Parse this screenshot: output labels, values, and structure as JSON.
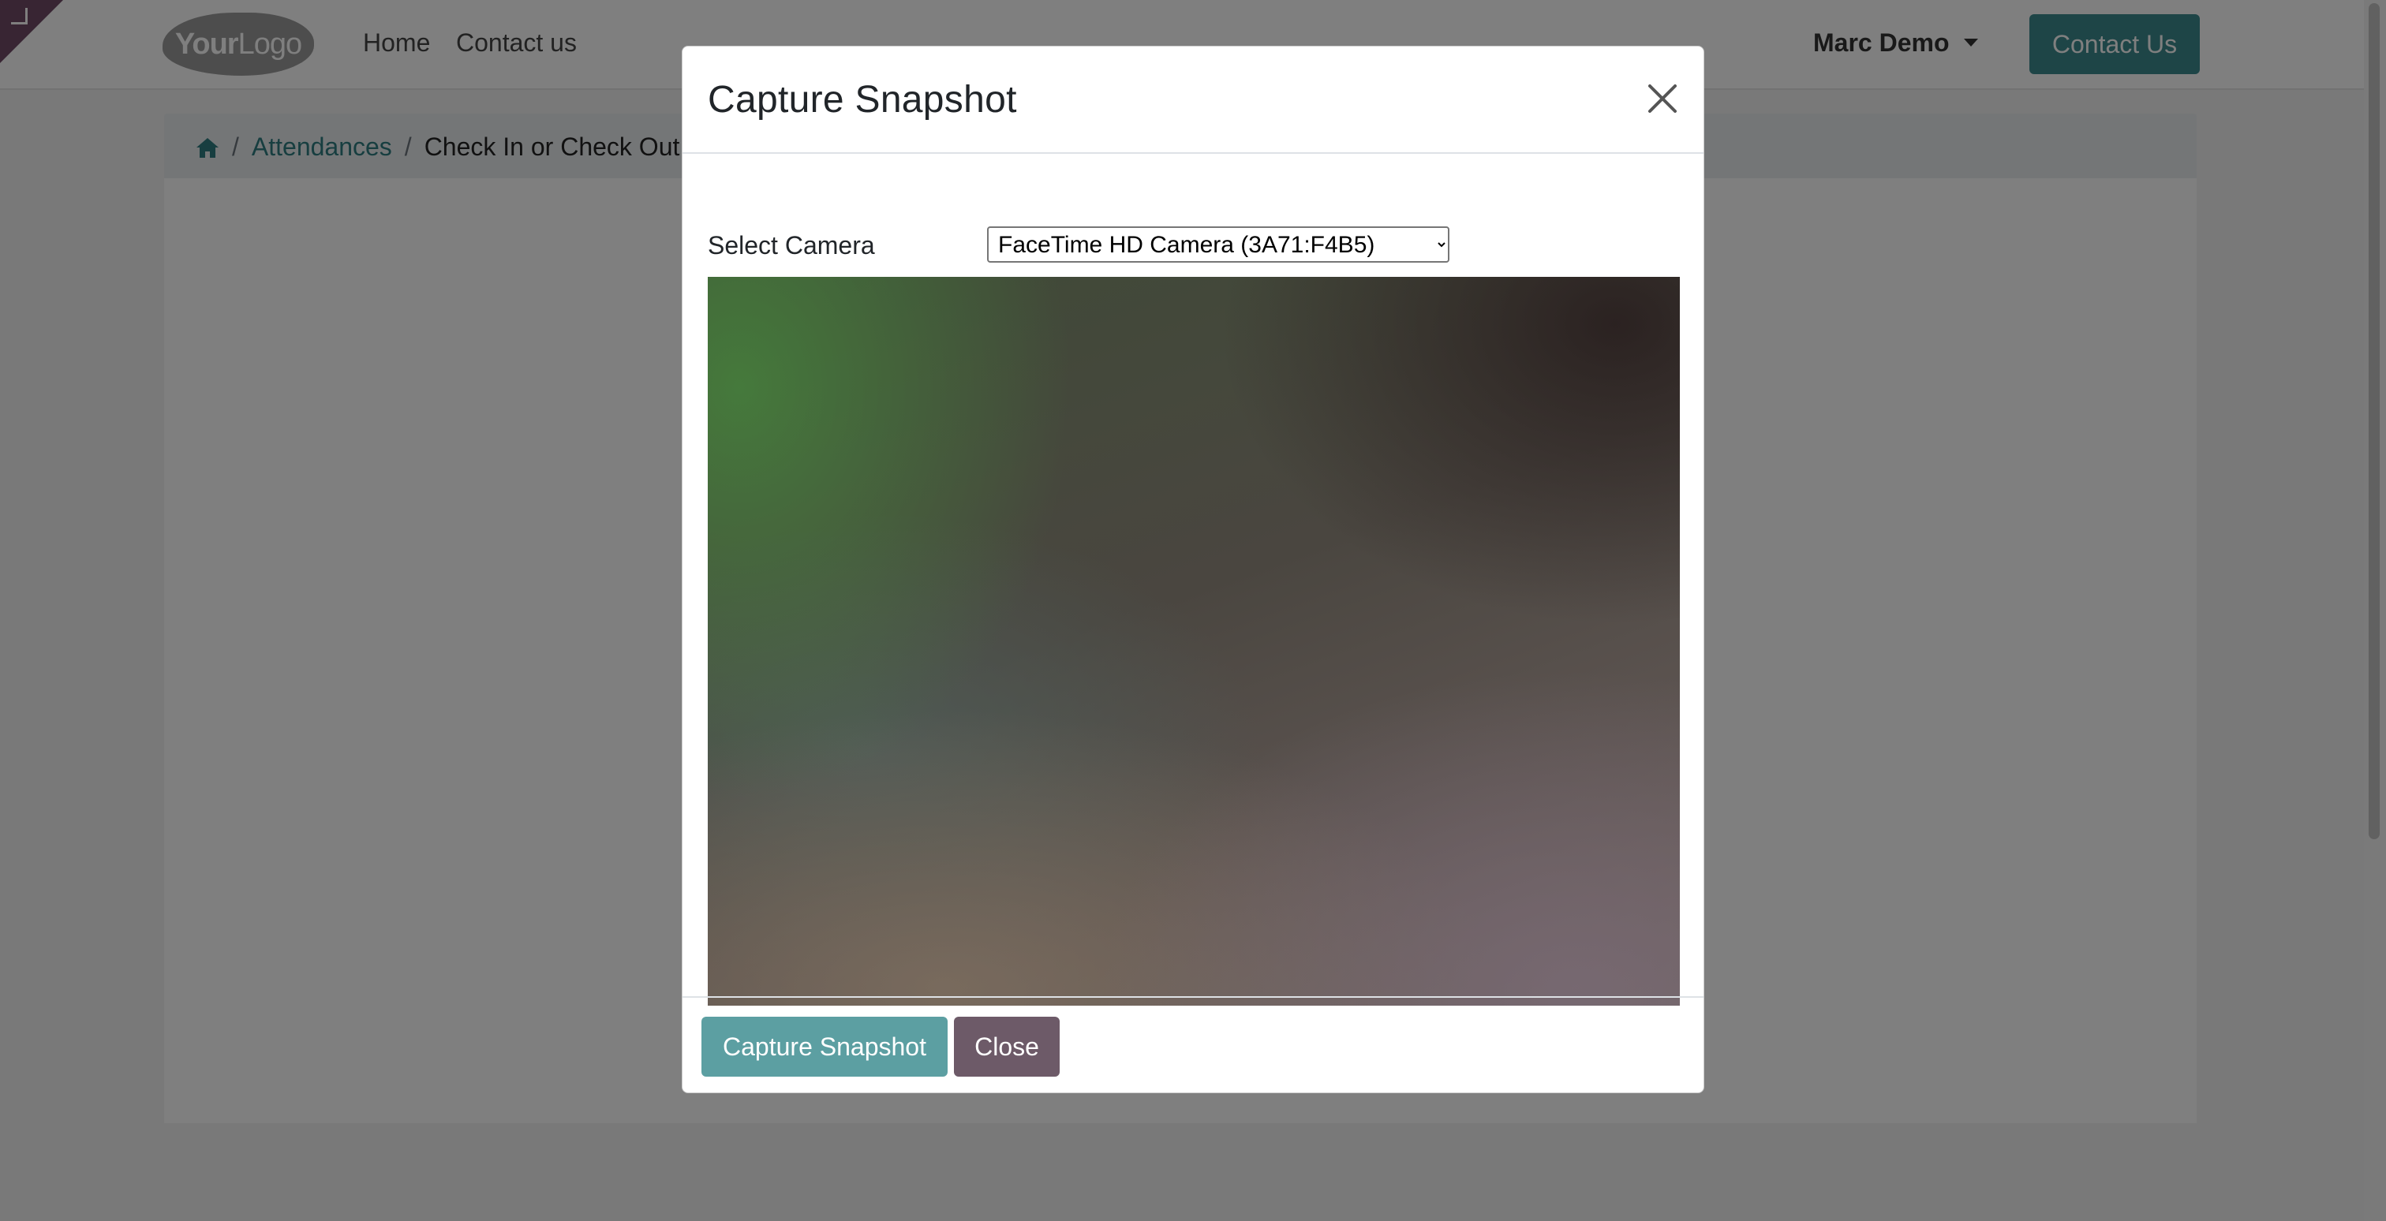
{
  "navbar": {
    "logo_text_bold": "Your",
    "logo_text_light": "Logo",
    "links": [
      "Home",
      "Contact us"
    ],
    "user_name": "Marc Demo",
    "cta_label": "Contact Us"
  },
  "breadcrumb": {
    "items": [
      "Attendances",
      "Check In or Check Out"
    ]
  },
  "modal": {
    "title": "Capture Snapshot",
    "camera_label": "Select Camera",
    "camera_selected": "FaceTime HD Camera (3A71:F4B5)",
    "capture_button": "Capture Snapshot",
    "close_button": "Close"
  },
  "colors": {
    "brand_corner": "#714b67",
    "primary": "#3c8b8e",
    "link": "#2e7d80",
    "secondary_button": "#6d5a68"
  },
  "icons": {
    "corner": "resize-corner-icon",
    "home": "home-icon",
    "dropdown": "caret-down-icon",
    "close": "close-icon"
  }
}
